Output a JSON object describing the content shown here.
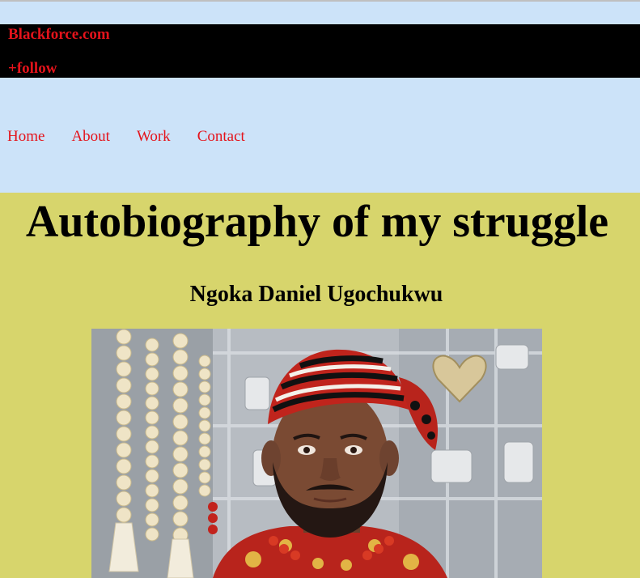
{
  "header": {
    "brand": "Blackforce.com",
    "follow": "+follow"
  },
  "nav": {
    "items": [
      "Home",
      "About",
      "Work",
      "Contact"
    ]
  },
  "main": {
    "title": "Autobiography of my struggle",
    "author": "Ngoka Daniel Ugochukwu"
  },
  "colors": {
    "page_bg": "#cce3f9",
    "header_bg": "#000000",
    "accent_red": "#e4131b",
    "content_bg": "#d7d56c"
  }
}
